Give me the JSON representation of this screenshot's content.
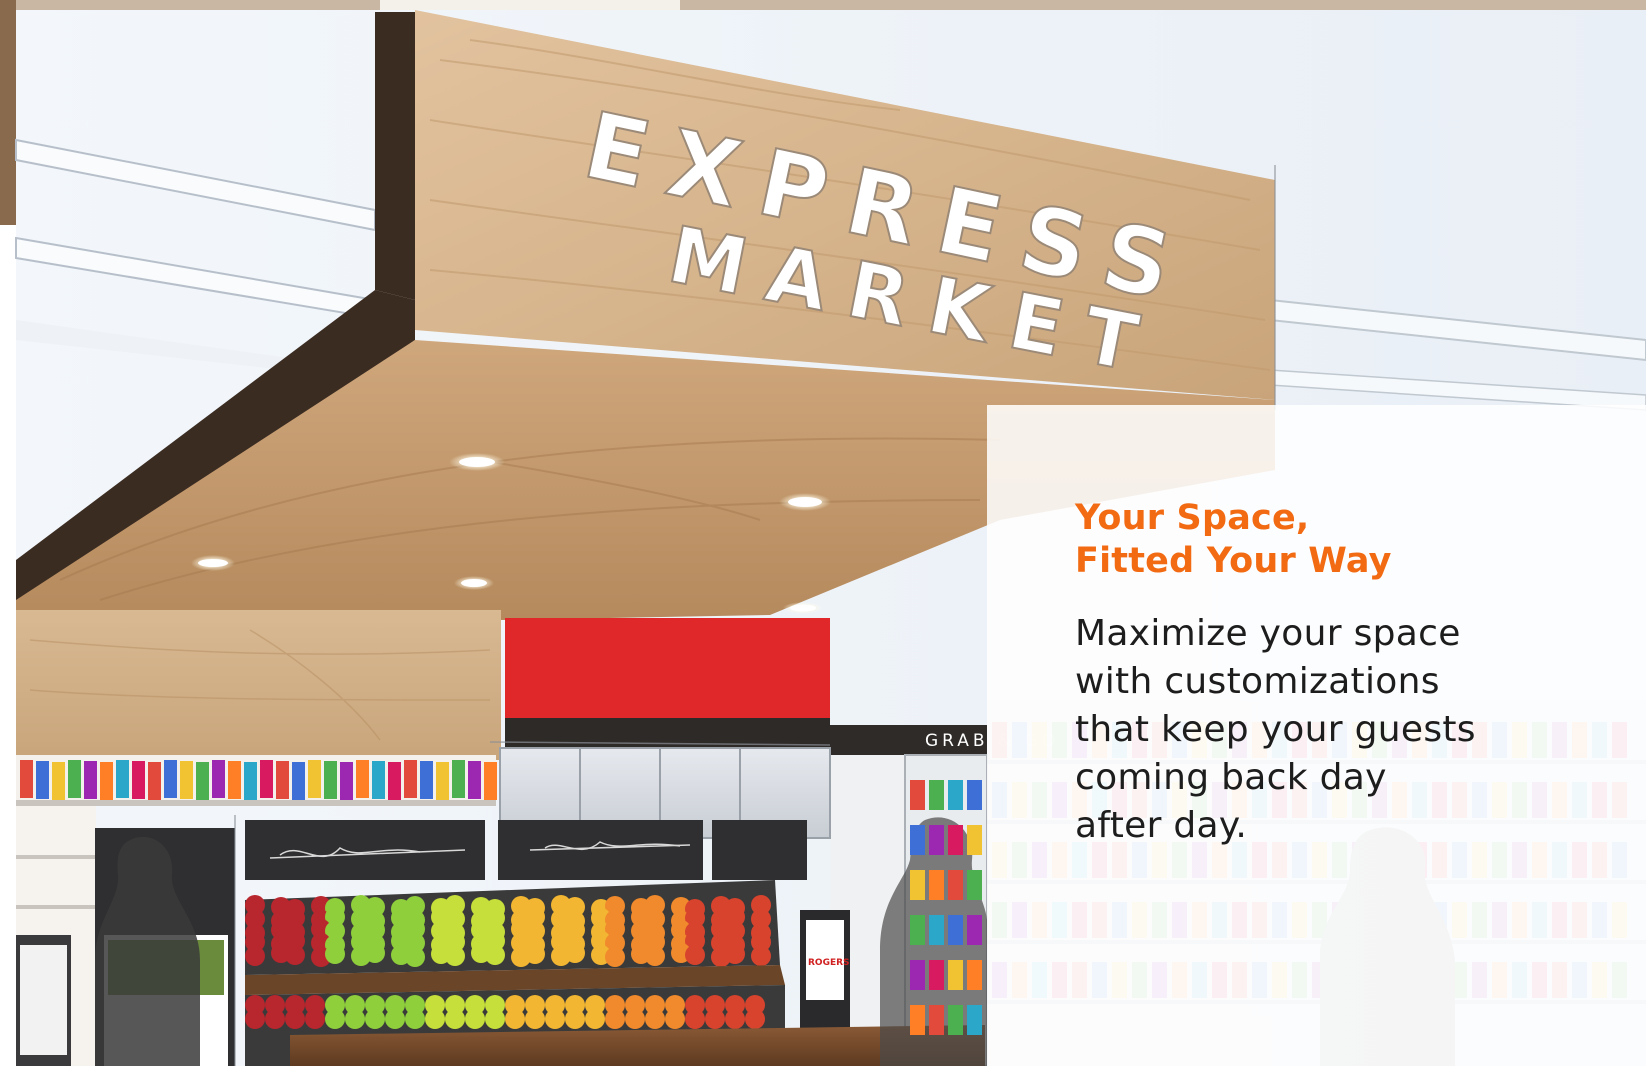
{
  "scene": {
    "sign_line_1": "EXPRESS",
    "sign_line_2": "MARKET",
    "wall_sign": "GRAB & GO",
    "kiosk_brand": "ROGERS"
  },
  "panel": {
    "title_line_1": "Your Space,",
    "title_line_2": "Fitted Your Way",
    "body_lines": [
      "Maximize your space",
      "with customizations",
      "that keep your guests",
      "coming back day",
      "after day."
    ]
  },
  "colors": {
    "accent": "#f26a12",
    "sign_wood": "#d9b892",
    "wall_red": "#e0282a",
    "body_text": "#1d1d1d"
  }
}
